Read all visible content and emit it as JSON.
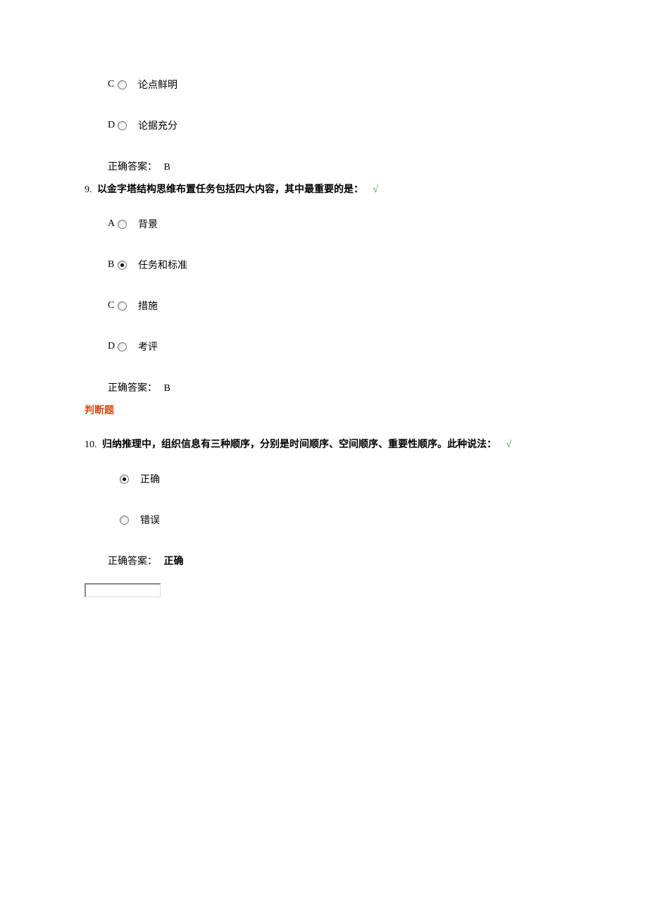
{
  "q_prev": {
    "options": [
      {
        "letter": "C",
        "text": "论点鲜明",
        "selected": false
      },
      {
        "letter": "D",
        "text": "论据充分",
        "selected": false
      }
    ],
    "answer_label": "正确答案：",
    "answer_value": "B"
  },
  "q9": {
    "number": "9.",
    "text": "以金字塔结构思维布置任务包括四大内容，其中最重要的是：",
    "check": "√",
    "options": [
      {
        "letter": "A",
        "text": "背景",
        "selected": false
      },
      {
        "letter": "B",
        "text": "任务和标准",
        "selected": true
      },
      {
        "letter": "C",
        "text": "措施",
        "selected": false
      },
      {
        "letter": "D",
        "text": "考评",
        "selected": false
      }
    ],
    "answer_label": "正确答案：",
    "answer_value": "B"
  },
  "section_tf": "判断题",
  "q10": {
    "number": "10.",
    "text": "归纳推理中，组织信息有三种顺序，分别是时间顺序、空间顺序、重要性顺序。此种说法：",
    "check": "√",
    "options": [
      {
        "text": "正确",
        "selected": true
      },
      {
        "text": "错误",
        "selected": false
      }
    ],
    "answer_label": "正确答案：",
    "answer_value": "正确"
  }
}
